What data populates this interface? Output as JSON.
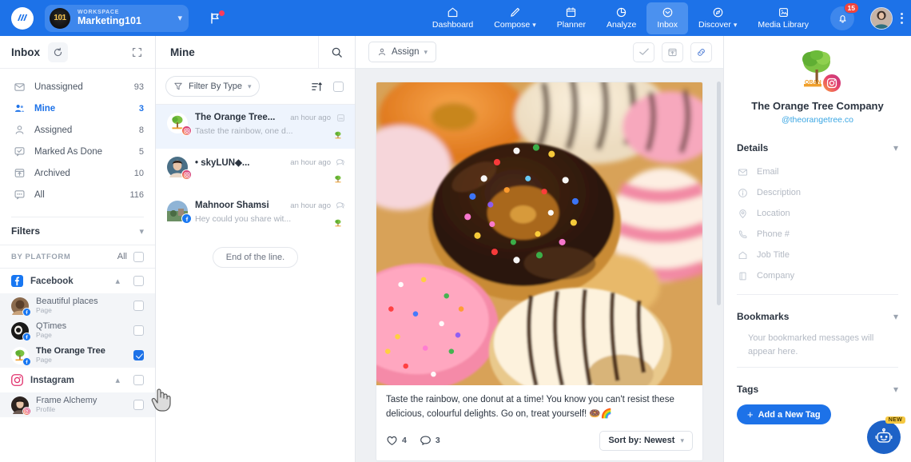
{
  "topbar": {
    "logo_icon": "brand-logo-icon",
    "workspace_label": "WORKSPACE",
    "workspace_name": "Marketing101",
    "workspace_avatar_text": "101",
    "flag_icon": "flag-icon",
    "nav": [
      {
        "label": "Dashboard",
        "icon": "home-icon",
        "caret": false,
        "active": false
      },
      {
        "label": "Compose",
        "icon": "pencil-icon",
        "caret": true,
        "active": false
      },
      {
        "label": "Planner",
        "icon": "calendar-icon",
        "caret": false,
        "active": false
      },
      {
        "label": "Analyze",
        "icon": "analytics-icon",
        "caret": false,
        "active": false
      },
      {
        "label": "Inbox",
        "icon": "inbox-icon",
        "caret": false,
        "active": true
      },
      {
        "label": "Discover",
        "icon": "compass-icon",
        "caret": true,
        "active": false
      },
      {
        "label": "Media Library",
        "icon": "media-library-icon",
        "caret": false,
        "active": false
      }
    ],
    "notification_count": "15",
    "bell_icon": "bell-icon",
    "avatar": "user-avatar",
    "kebab_icon": "kebab-menu-icon"
  },
  "sidebar": {
    "title": "Inbox",
    "refresh_icon": "refresh-icon",
    "expand_icon": "expand-icon",
    "folders": [
      {
        "label": "Unassigned",
        "count": "93",
        "icon": "unassigned-icon",
        "active": false
      },
      {
        "label": "Mine",
        "count": "3",
        "icon": "mine-icon",
        "active": true
      },
      {
        "label": "Assigned",
        "count": "8",
        "icon": "person-icon",
        "active": false
      },
      {
        "label": "Marked As Done",
        "count": "5",
        "icon": "check-chat-icon",
        "active": false
      },
      {
        "label": "Archived",
        "count": "10",
        "icon": "archive-icon",
        "active": false
      },
      {
        "label": "All",
        "count": "116",
        "icon": "all-chat-icon",
        "active": false
      }
    ],
    "filters_label": "Filters",
    "by_platform_label": "BY PLATFORM",
    "all_label": "All",
    "platforms": [
      {
        "name": "Facebook",
        "icon": "facebook-icon",
        "checked": false,
        "accounts": [
          {
            "name": "Beautiful places",
            "type": "Page",
            "checked": false,
            "badge": "facebook-badge"
          },
          {
            "name": "QTimes",
            "type": "Page",
            "checked": false,
            "badge": "facebook-badge"
          },
          {
            "name": "The Orange Tree",
            "type": "Page",
            "checked": true,
            "badge": "facebook-badge"
          }
        ]
      },
      {
        "name": "Instagram",
        "icon": "instagram-icon",
        "checked": false,
        "accounts": [
          {
            "name": "Frame Alchemy",
            "type": "Profile",
            "checked": false,
            "badge": "instagram-badge"
          }
        ]
      }
    ]
  },
  "midcol": {
    "title": "Mine",
    "search_icon": "search-icon",
    "filter_label": "Filter By Type",
    "filter_icon": "funnel-icon",
    "sort_icon": "sort-icon",
    "conversations": [
      {
        "name": "The Orange Tree...",
        "time": "an hour ago",
        "snippet": "Taste the rainbow, one d...",
        "type_icon": "post-icon",
        "active": true,
        "badge": "instagram-badge"
      },
      {
        "name": "• skyLUN◆...",
        "time": "an hour ago",
        "snippet": "",
        "type_icon": "comment-icon",
        "active": false,
        "badge": "instagram-badge"
      },
      {
        "name": "Mahnoor Shamsi",
        "time": "an hour ago",
        "snippet": "Hey could you share wit...",
        "type_icon": "comment-icon",
        "active": false,
        "badge": "facebook-badge"
      }
    ],
    "end_label": "End of the line."
  },
  "main": {
    "assign_label": "Assign",
    "assign_icon": "person-icon",
    "header_buttons": [
      {
        "icon": "mark-done-icon",
        "name": "mark-as-done-button"
      },
      {
        "icon": "archive-icon",
        "name": "archive-button"
      },
      {
        "icon": "link-icon",
        "name": "copy-link-button"
      }
    ],
    "post": {
      "image_alt": "assorted-donuts-photo",
      "caption": "Taste the rainbow, one donut at a time! You know you can't resist these delicious, colourful delights. Go on, treat yourself! 🍩🌈",
      "likes": "4",
      "comments": "3",
      "like_icon": "heart-icon",
      "comment_icon": "comment-bubble-icon",
      "sort_label": "Sort by: Newest"
    }
  },
  "rightpanel": {
    "profile_name": "The Orange Tree Company",
    "profile_handle": "@theorangetree.co",
    "profile_logo_icon": "orange-tree-logo-icon",
    "profile_badge_icon": "instagram-badge",
    "details_title": "Details",
    "details": [
      {
        "label": "Email",
        "icon": "envelope-icon"
      },
      {
        "label": "Description",
        "icon": "info-icon"
      },
      {
        "label": "Location",
        "icon": "map-pin-icon"
      },
      {
        "label": "Phone #",
        "icon": "phone-icon"
      },
      {
        "label": "Job Title",
        "icon": "briefcase-icon"
      },
      {
        "label": "Company",
        "icon": "building-icon"
      }
    ],
    "bookmarks_title": "Bookmarks",
    "bookmarks_empty": "Your bookmarked messages will appear here.",
    "tags_title": "Tags",
    "add_tag_label": "Add a New Tag"
  },
  "chatbot": {
    "icon": "chatbot-icon",
    "new_badge": "NEW"
  },
  "colors": {
    "brand_blue": "#1d72e8",
    "accent_link": "#3aa6e3",
    "badge_red": "#f2453d",
    "checked_blue": "#1d72e8",
    "new_yellow": "#f5c842"
  }
}
